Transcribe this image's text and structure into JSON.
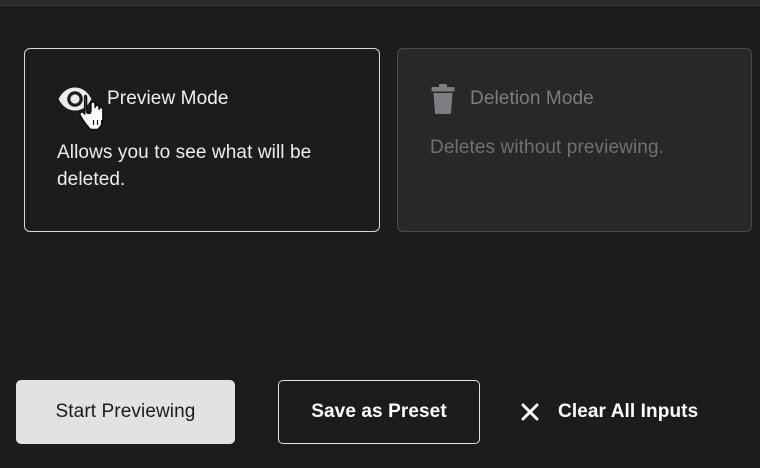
{
  "modes": {
    "preview": {
      "title": "Preview Mode",
      "description": "Allows you to see what will be deleted.",
      "icon": "eye-icon"
    },
    "deletion": {
      "title": "Deletion Mode",
      "description": "Deletes without previewing.",
      "icon": "trash-icon"
    }
  },
  "actions": {
    "start_label": "Start Previewing",
    "preset_label": "Save as Preset",
    "clear_label": "Clear All Inputs",
    "clear_icon": "close-icon"
  },
  "colors": {
    "background": "#1c1c1c",
    "selected_border": "#d9d9d9",
    "disabled_card_bg": "#27282a",
    "disabled_text": "#7c7d80",
    "primary_button_bg": "#e2e2e2"
  }
}
